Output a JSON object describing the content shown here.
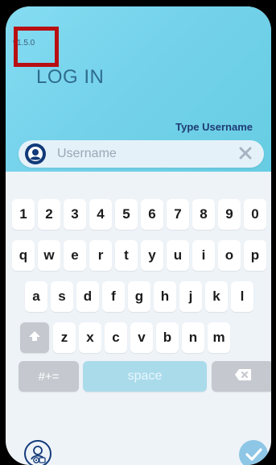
{
  "app": {
    "version": "v1.5.0",
    "title": "LOG IN",
    "hint": "Type Username"
  },
  "username_field": {
    "placeholder": "Username",
    "value": ""
  },
  "keyboard": {
    "row1": [
      "1",
      "2",
      "3",
      "4",
      "5",
      "6",
      "7",
      "8",
      "9",
      "0"
    ],
    "row2": [
      "q",
      "w",
      "e",
      "r",
      "t",
      "y",
      "u",
      "i",
      "o",
      "p"
    ],
    "row3": [
      "a",
      "s",
      "d",
      "f",
      "g",
      "h",
      "j",
      "k",
      "l"
    ],
    "row4": [
      "z",
      "x",
      "c",
      "v",
      "b",
      "n",
      "m"
    ],
    "symbols_label": "#+=",
    "space_label": "space"
  },
  "icons": {
    "avatar": "user-avatar-icon",
    "clear": "clear-icon",
    "shift": "shift-arrow-icon",
    "backspace": "backspace-icon",
    "profile_settings": "profile-settings-icon",
    "confirm": "checkmark-icon"
  },
  "colors": {
    "header_gradient_start": "#84dcf2",
    "header_gradient_end": "#67cde3",
    "title_text": "#2f6c8d",
    "hint_text": "#1f3b74",
    "highlight_box": "#b80f12",
    "space_key": "#aadbeb",
    "confirm_button": "#8ec6e6"
  }
}
